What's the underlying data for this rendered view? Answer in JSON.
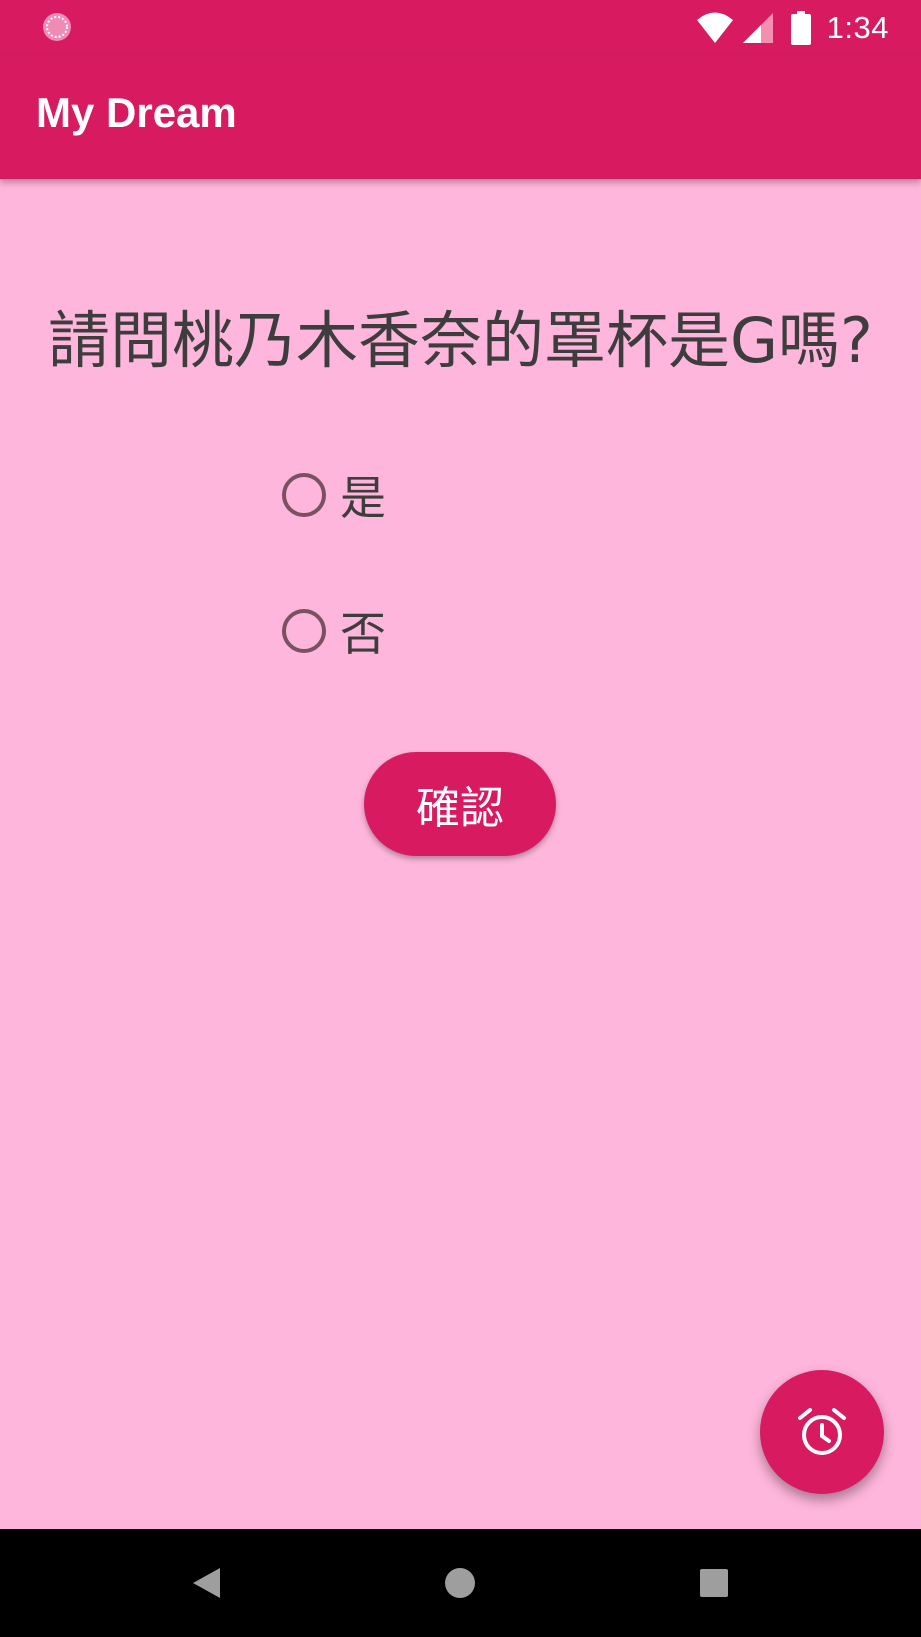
{
  "status_bar": {
    "time": "1:34",
    "icons": [
      "loading-circle-icon",
      "wifi-icon",
      "cell-signal-icon",
      "battery-icon"
    ]
  },
  "app_bar": {
    "title": "My Dream"
  },
  "question": {
    "text": "請問桃乃木香奈的罩杯是G嗎?"
  },
  "options": [
    {
      "label": "是",
      "checked": false
    },
    {
      "label": "否",
      "checked": false
    }
  ],
  "confirm_button": {
    "label": "確認"
  },
  "fab": {
    "icon": "alarm-icon"
  },
  "nav_bar": {
    "icons": [
      "back-icon",
      "home-icon",
      "recents-icon"
    ]
  },
  "colors": {
    "primary": "#d81b60",
    "background": "#ffb6dc",
    "text": "#3d3d3d",
    "radio_outline": "#7a5160"
  }
}
